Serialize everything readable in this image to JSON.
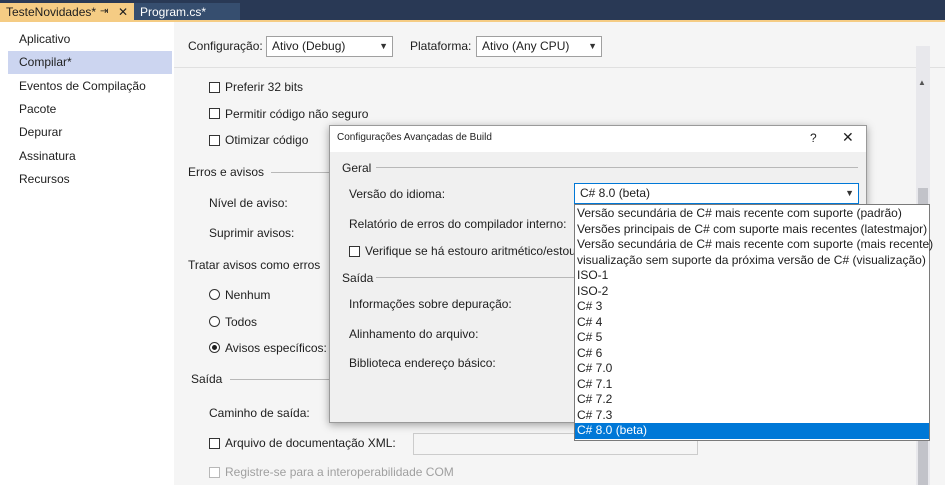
{
  "tabs": [
    {
      "label": "TesteNovidades*",
      "pin_icon": "pin-icon",
      "close_icon": "close-icon"
    },
    {
      "label": "Program.cs*"
    }
  ],
  "tab_pin": "⇥",
  "tab_close": "✕",
  "nav": {
    "items": [
      "Aplicativo",
      "Compilar*",
      "Eventos de Compilação",
      "Pacote",
      "Depurar",
      "Assinatura",
      "Recursos"
    ],
    "selected_index": 1
  },
  "config": {
    "config_label": "Configuração:",
    "config_value": "Ativo (Debug)",
    "platform_label": "Plataforma:",
    "platform_value": "Ativo (Any CPU)"
  },
  "build": {
    "prefer32": "Preferir 32 bits",
    "unsafe": "Permitir código não seguro",
    "optimize": "Otimizar código",
    "errors_section": "Erros e avisos",
    "warning_level": "Nível de aviso:",
    "suppress": "Suprimir avisos:",
    "treat_section": "Tratar avisos como erros",
    "radio_none": "Nenhum",
    "radio_all": "Todos",
    "radio_specific": "Avisos específicos:",
    "output_section": "Saída",
    "output_path": "Caminho de saída:",
    "xml_doc": "Arquivo de documentação XML:",
    "com_interop": "Registre-se para a interoperabilidade COM"
  },
  "dialog": {
    "title": "Configurações Avançadas de Build",
    "help": "?",
    "close": "✕",
    "general_section": "Geral",
    "lang_version_label": "Versão do idioma:",
    "lang_version_value": "C# 8.0 (beta)",
    "error_report_label": "Relatório de erros do compilador interno:",
    "overflow_check": "Verifique se há estouro aritmético/estouro",
    "output_section": "Saída",
    "debug_info": "Informações sobre depuração:",
    "file_alignment": "Alinhamento do arquivo:",
    "base_address": "Biblioteca endereço básico:"
  },
  "dropdown": {
    "options": [
      "Versão secundária de C# mais recente com suporte (padrão)",
      "Versões principais de C# com suporte mais recentes (latestmajor)",
      "Versão secundária de C# mais recente com suporte (mais recente)",
      "visualização sem suporte da próxima versão de C# (visualização)",
      "ISO-1",
      "ISO-2",
      "C# 3",
      "C# 4",
      "C# 5",
      "C# 6",
      "C# 7.0",
      "C# 7.1",
      "C# 7.2",
      "C# 7.3",
      "C# 8.0 (beta)"
    ],
    "selected_index": 14
  },
  "colors": {
    "tabstrip": "#293955",
    "active_tab": "#f5cc84",
    "nav_selected": "#ccd5f0",
    "dropdown_selected": "#0078d7"
  }
}
